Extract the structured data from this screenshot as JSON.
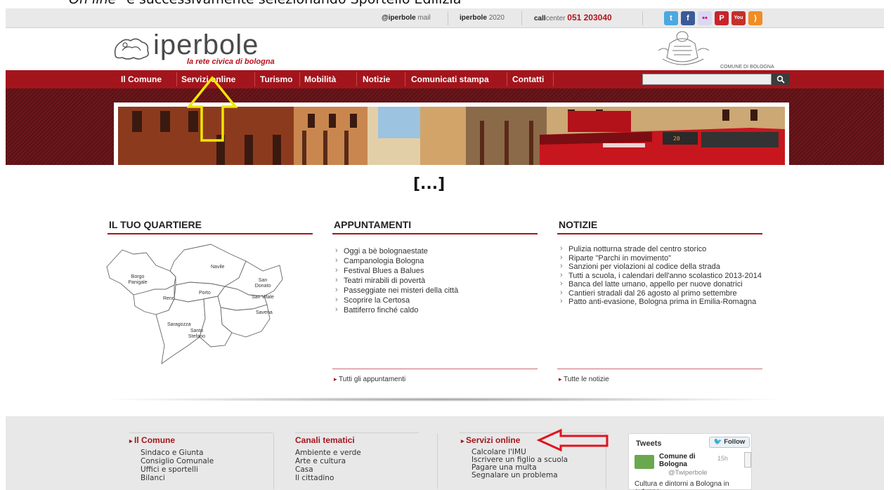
{
  "document_caption": {
    "italic": "On line",
    "rest": "\" e successivamente selezionando Sportello Edilizia"
  },
  "topbar": {
    "mail_brand": "@iperbole",
    "mail_word": "mail",
    "iperbole_word": "iperbole",
    "year": "2020",
    "call_strong": "call",
    "call_rest": "center",
    "call_number": "051 203040",
    "social": [
      {
        "name": "twitter-icon",
        "glyph": "t",
        "color": "#4aa9e0"
      },
      {
        "name": "facebook-icon",
        "glyph": "f",
        "color": "#3b5b98"
      },
      {
        "name": "flickr-icon",
        "glyph": "••",
        "color": "#d9d9f0"
      },
      {
        "name": "pinterest-icon",
        "glyph": "P",
        "color": "#c8232c"
      },
      {
        "name": "youtube-icon",
        "glyph": "You",
        "color": "#c4302b"
      },
      {
        "name": "rss-icon",
        "glyph": ")",
        "color": "#f18c24"
      }
    ]
  },
  "header": {
    "logo_text": "iperbole",
    "logo_sub": "la rete civica di bologna",
    "coat_label": "COMUNE DI BOLOGNA"
  },
  "nav": {
    "items": [
      "Il Comune",
      "Servizi online",
      "Turismo",
      "Mobilità",
      "Notizie",
      "Comunicati stampa",
      "Contatti"
    ],
    "search_placeholder": "",
    "search_icon": "search-icon"
  },
  "ellipsis": "[...]",
  "quartiere": {
    "title": "IL TUO QUARTIERE",
    "labels": [
      "Navile",
      "Borgo Panigale",
      "San Donato",
      "Porto",
      "Reno",
      "San Vitale",
      "Savena",
      "Saragozza",
      "Santo Stefano"
    ]
  },
  "appuntamenti": {
    "title": "APPUNTAMENTI",
    "items": [
      "Oggi a bè bolognaestate",
      "Campanologia Bologna",
      "Festival Blues a Balues",
      "Teatri mirabili di povertà",
      "Passeggiate nei misteri della città",
      "Scoprire la Certosa",
      "Battiferro finché caldo"
    ],
    "footer_link": "Tutti gli appuntamenti"
  },
  "notizie": {
    "title": "NOTIZIE",
    "items": [
      "Pulizia notturna strade del centro storico",
      "Riparte \"Parchi in movimento\"",
      "Sanzioni per violazioni al codice della strada",
      "Tutti a scuola, i calendari dell'anno scolastico 2013-2014",
      "Banca del latte umano, appello per nuove donatrici",
      "Cantieri stradali dal 26 agosto al primo settembre",
      "Patto anti-evasione, Bologna prima in Emilia-Romagna"
    ],
    "footer_link": "Tutte le notizie"
  },
  "footer": {
    "col1": {
      "title": "Il Comune",
      "items": [
        "Sindaco e Giunta",
        "Consiglio Comunale",
        "Uffici e sportelli",
        "Bilanci"
      ]
    },
    "col2": {
      "title": "Canali tematici",
      "items": [
        "Ambiente e verde",
        "Arte e cultura",
        "Casa",
        "Il cittadino"
      ]
    },
    "col3": {
      "title": "Servizi online",
      "items": [
        "Calcolare l'IMU",
        "Iscrivere un figlio a scuola",
        "Pagare una multa",
        "Segnalare un problema"
      ]
    },
    "tweets": {
      "title": "Tweets",
      "follow_label": "Follow",
      "name": "Comune di Bologna",
      "handle": "@Twiperbole",
      "time": "15h",
      "text": "Cultura e dintorni a Bologna in autunno"
    }
  },
  "colors": {
    "brand_red": "#a3151c",
    "annotation_yellow": "#f2e600",
    "annotation_red": "#e0141e"
  }
}
